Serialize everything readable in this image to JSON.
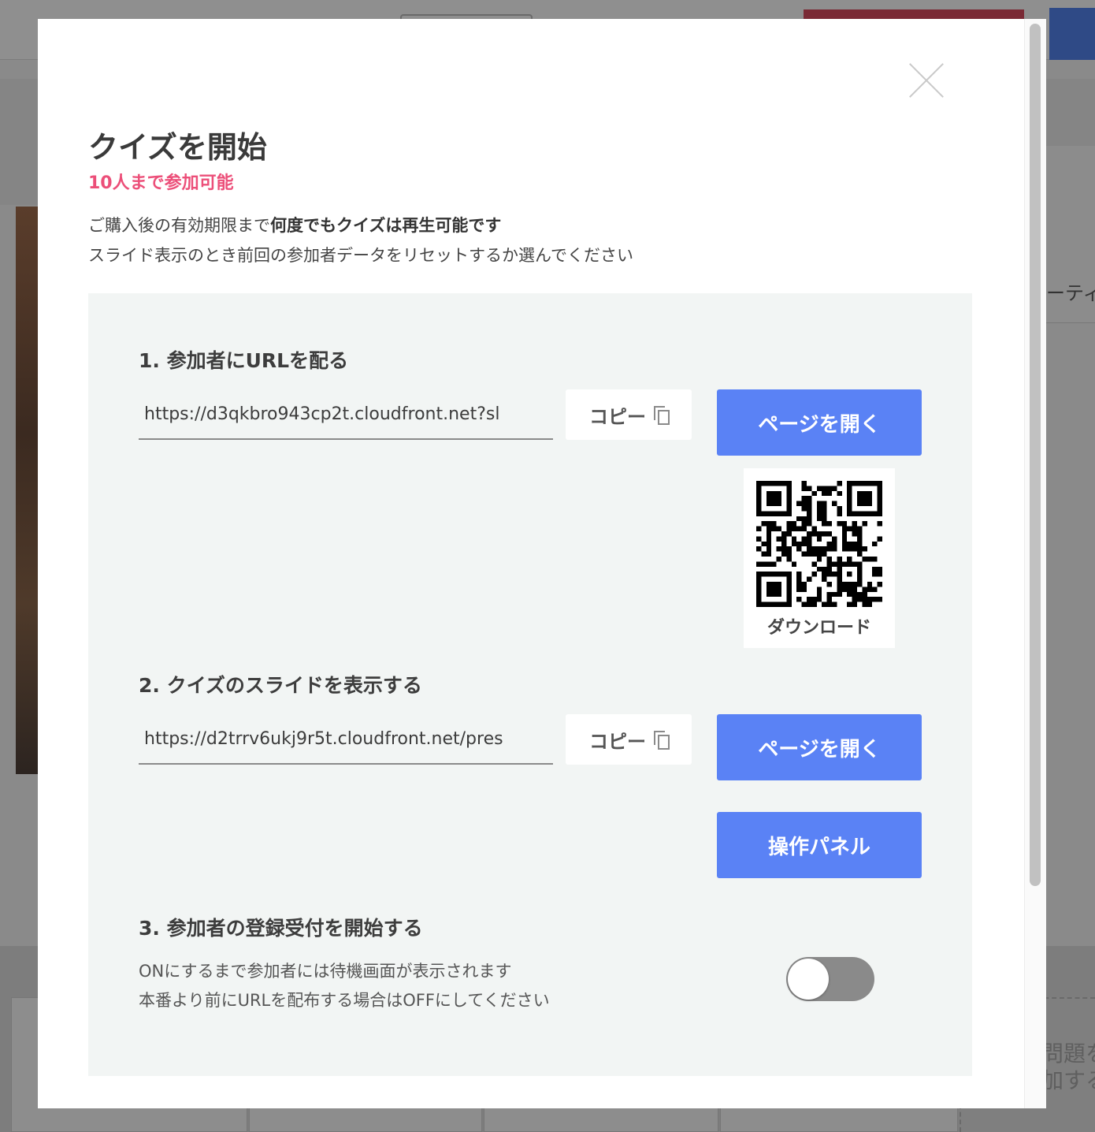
{
  "modal": {
    "title": "クイズを開始",
    "limit": "10人まで参加可能",
    "desc_line1_prefix": "ご購入後の有効期限まで",
    "desc_line1_bold": "何度でもクイズは再生可能です",
    "desc_line2": "スライド表示のとき前回の参加者データをリセットするか選んでください"
  },
  "step1": {
    "title": "1. 参加者にURLを配る",
    "url": "https://d3qkbro943cp2t.cloudfront.net?sl",
    "copy_label": "コピー",
    "open_label": "ページを開く",
    "qr_download": "ダウンロード"
  },
  "step2": {
    "title": "2. クイズのスライドを表示する",
    "url": "https://d2trrv6ukj9r5t.cloudfront.net/pres",
    "copy_label": "コピー",
    "open_label": "ページを開く",
    "panel_label": "操作パネル"
  },
  "step3": {
    "title": "3. 参加者の登録受付を開始する",
    "desc_line1": "ONにするまで参加者には待機画面が表示されます",
    "desc_line2": "本番より前にURLを配布する場合はOFFにしてください",
    "toggle_on": false
  },
  "background": {
    "right_text": "ーティ",
    "dashed_text_line1": "問題を",
    "dashed_text_line2": "加する"
  },
  "colors": {
    "accent": "#5a82f5",
    "limit": "#ec4f79",
    "panel_bg": "#f2f5f4"
  },
  "icons": [
    "close-icon",
    "copy-icon",
    "qr-code-icon"
  ]
}
